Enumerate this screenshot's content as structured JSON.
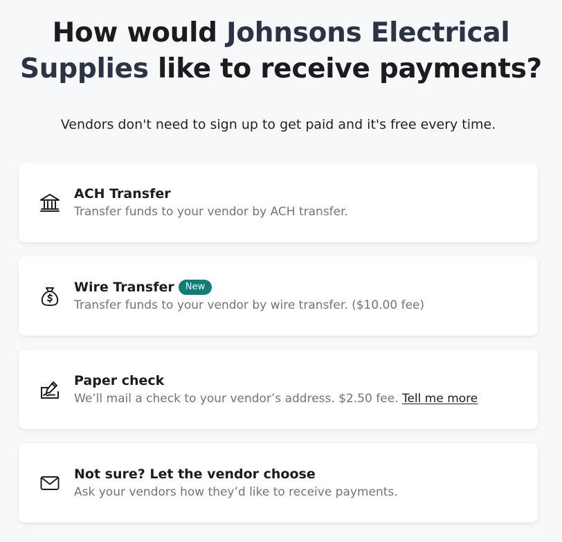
{
  "header": {
    "title_before": "How would ",
    "vendor_name": "Johnsons Electrical Supplies",
    "title_after": " like to receive payments?",
    "subtitle": "Vendors don't need to sign up to get paid and it's free every time."
  },
  "options": [
    {
      "id": "ach",
      "icon": "bank-icon",
      "title": "ACH Transfer",
      "description": "Transfer funds to your vendor by ACH transfer."
    },
    {
      "id": "wire",
      "icon": "money-bag-icon",
      "title": "Wire Transfer",
      "badge": "New",
      "description": "Transfer funds to your vendor by wire transfer. ($10.00 fee)"
    },
    {
      "id": "check",
      "icon": "check-signing-icon",
      "title": "Paper check",
      "description": "We’ll mail a check to your vendor’s address. $2.50 fee. ",
      "link_label": "Tell me more"
    },
    {
      "id": "unsure",
      "icon": "envelope-icon",
      "title": "Not sure? Let the vendor choose",
      "description": "Ask your vendors how they’d like to receive payments."
    }
  ],
  "colors": {
    "background": "#f7f8fa",
    "vendor_name": "#2b3445",
    "badge": "#127d74",
    "description_text": "#6d7382"
  }
}
